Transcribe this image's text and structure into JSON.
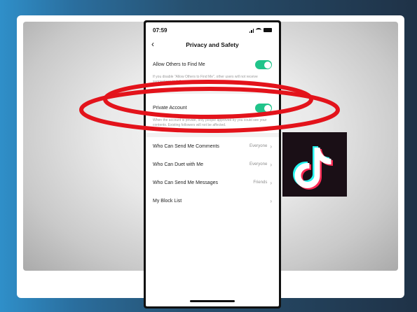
{
  "phone": {
    "time": "07:59",
    "title": "Privacy and Safety",
    "allow_find": {
      "label": "Allow Others to Find Me",
      "enabled": true,
      "hint": "If you disable \"Allow Others to Find Me\", other users will not receive suggestions to follow you."
    },
    "private_account": {
      "label": "Private Account",
      "enabled": true,
      "hint": "When the account is private, only people approved by you could see your contents. Existing followers will not be affected."
    },
    "settings": [
      {
        "label": "Who Can Send Me Comments",
        "value": "Everyone"
      },
      {
        "label": "Who Can Duet with Me",
        "value": "Everyone"
      },
      {
        "label": "Who Can Send Me Messages",
        "value": "Friends"
      },
      {
        "label": "My Block List",
        "value": ""
      }
    ]
  },
  "colors": {
    "toggle_on": "#20c48a",
    "highlight": "#e3131b",
    "tiktok_cyan": "#25f4ee",
    "tiktok_red": "#fe2c55"
  },
  "icons": [
    "back-chevron-icon",
    "signal-icon",
    "wifi-icon",
    "battery-icon",
    "chevron-right-icon",
    "tiktok-logo"
  ]
}
